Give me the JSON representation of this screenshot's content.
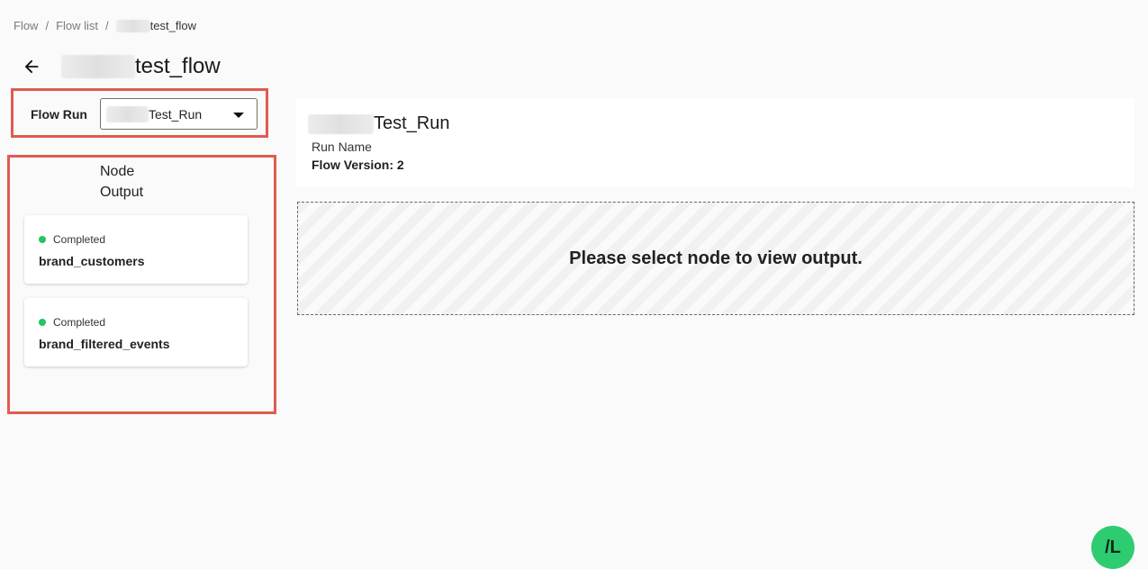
{
  "breadcrumb": {
    "items": [
      "Flow",
      "Flow list"
    ],
    "separator": "/",
    "current_suffix": "test_flow"
  },
  "header": {
    "title_suffix": "test_flow",
    "back_icon": "arrow-left-icon"
  },
  "run_selector": {
    "label": "Flow Run",
    "selected_suffix": "Test_Run"
  },
  "node_output": {
    "heading_line1": "Node",
    "heading_line2": "Output",
    "nodes": [
      {
        "status": "Completed",
        "name": "brand_customers",
        "status_color": "#22c55e"
      },
      {
        "status": "Completed",
        "name": "brand_filtered_events",
        "status_color": "#22c55e"
      }
    ]
  },
  "run_info": {
    "title_suffix": "Test_Run",
    "subtitle": "Run Name",
    "version": "Flow Version: 2"
  },
  "output": {
    "placeholder": "Please select node to view output."
  },
  "fab": {
    "label": "/L"
  }
}
